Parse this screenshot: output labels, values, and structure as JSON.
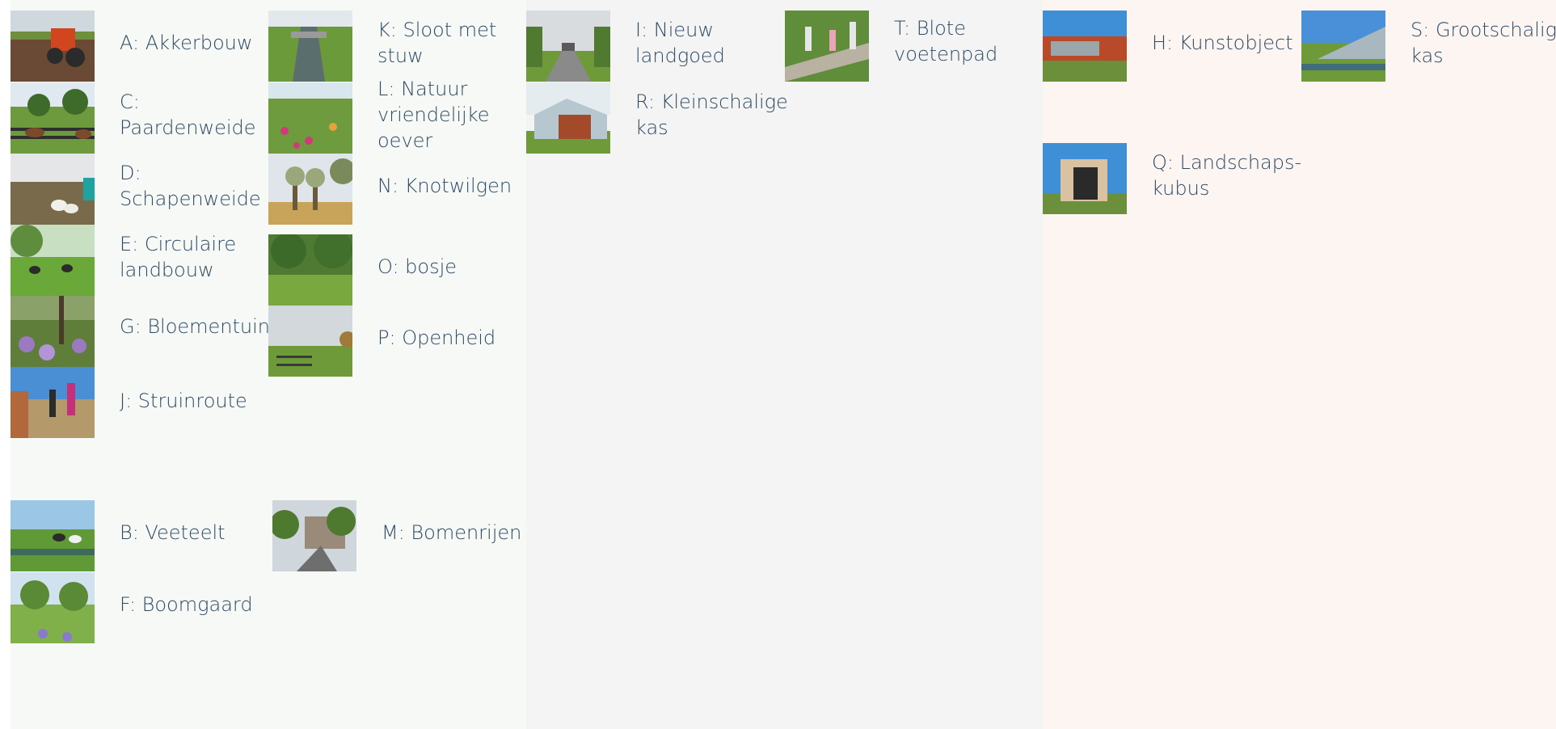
{
  "colors": {
    "text": "#2e4a63",
    "panel_left": "#f6f9f5",
    "panel_middle": "#f4f4f4",
    "panel_right": "#fdf5f2"
  },
  "panels": {
    "left": {
      "items": {
        "A": {
          "label": "A: Akkerbouw",
          "photo": "tractor-field-photo"
        },
        "C": {
          "label": "C: Paardenweide",
          "photo": "horse-paddock-photo"
        },
        "D": {
          "label": "D: Schapenweide",
          "photo": "sheep-pasture-photo"
        },
        "E": {
          "label": "E: Circulaire landbouw",
          "photo": "grazing-cattle-photo"
        },
        "G": {
          "label": "G: Bloementuin",
          "photo": "flower-garden-photo"
        },
        "J": {
          "label": "J: Struinroute",
          "photo": "walking-route-photo"
        },
        "K": {
          "label": "K: Sloot met stuw",
          "photo": "ditch-weir-photo"
        },
        "L": {
          "label": "L: Natuur vriendelijke oever",
          "photo": "nature-bank-photo"
        },
        "N": {
          "label": "N: Knotwilgen",
          "photo": "pollard-willows-photo"
        },
        "O": {
          "label": "O: bosje",
          "photo": "small-wood-photo"
        },
        "P": {
          "label": "P: Openheid",
          "photo": "open-landscape-photo"
        },
        "B": {
          "label": "B: Veeteelt",
          "photo": "livestock-photo"
        },
        "F": {
          "label": "F: Boomgaard",
          "photo": "orchard-photo"
        },
        "M": {
          "label": "M: Bomenrijen",
          "photo": "tree-rows-photo"
        }
      }
    },
    "middle": {
      "items": {
        "I": {
          "label": "I: Nieuw landgoed",
          "photo": "estate-lane-photo"
        },
        "R": {
          "label": "R: Kleinschalige kas",
          "photo": "small-greenhouse-photo"
        },
        "T": {
          "label": "T: Blote voetenpad",
          "photo": "barefoot-path-photo"
        }
      }
    },
    "right": {
      "items": {
        "H": {
          "label": "H: Kunstobject",
          "photo": "art-object-photo"
        },
        "S": {
          "label": "S: Grootschalige kas",
          "photo": "large-greenhouse-photo"
        },
        "Q": {
          "label": "Q: Landschaps-kubus",
          "photo": "landscape-cube-photo"
        }
      }
    }
  }
}
